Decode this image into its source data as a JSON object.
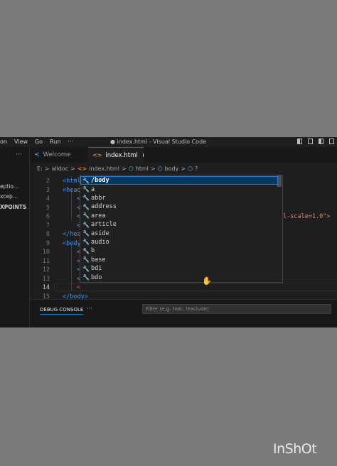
{
  "titlebar": {
    "menu": [
      "on",
      "View",
      "Go",
      "Run",
      "···"
    ],
    "window_title": "● index.html - Visual Studio Code"
  },
  "sidebar": {
    "dots": "···",
    "lines": [
      "eptio...",
      "xcep...",
      "XPOINTS"
    ]
  },
  "tabs": [
    {
      "label": "Welcome",
      "icon": "vscode-icon"
    },
    {
      "label": "index.html",
      "icon": "html-file-icon",
      "dirty": true
    }
  ],
  "breadcrumb": {
    "items": [
      "E:",
      ">",
      "alldoc",
      ">",
      "index.html",
      ">",
      "html",
      ">",
      "body",
      ">",
      "?"
    ]
  },
  "editor": {
    "lines": [
      {
        "num": "2",
        "text": "<html"
      },
      {
        "num": "3",
        "text": "<head"
      },
      {
        "num": "4",
        "text": "<"
      },
      {
        "num": "5",
        "text": "<"
      },
      {
        "num": "6",
        "text": "<"
      },
      {
        "num": "7",
        "text": "<"
      },
      {
        "num": "8",
        "text": "</hea"
      },
      {
        "num": "9",
        "text": "<body"
      },
      {
        "num": "10",
        "text": "<"
      },
      {
        "num": "11",
        "text": "<"
      },
      {
        "num": "12",
        "text": "<"
      },
      {
        "num": "13",
        "text": "<"
      },
      {
        "num": "14",
        "text": "<"
      },
      {
        "num": "15",
        "text": "</body>"
      }
    ],
    "line6_tail": "l-scale=1.0\">",
    "current_line": "14"
  },
  "suggest": {
    "items": [
      "/body",
      "a",
      "abbr",
      "address",
      "area",
      "article",
      "aside",
      "audio",
      "b",
      "base",
      "bdi",
      "bdo"
    ],
    "selected_index": 0
  },
  "panel": {
    "tab": "DEBUG CONSOLE",
    "dots": "···",
    "filter_placeholder": "Filter (e.g. text, !exclude)"
  },
  "watermark": "InShOt",
  "colors": {
    "background": "#7b7b7d",
    "editor_bg": "#1e1e1e",
    "accent": "#0078d4",
    "tag": "#3794ff"
  }
}
